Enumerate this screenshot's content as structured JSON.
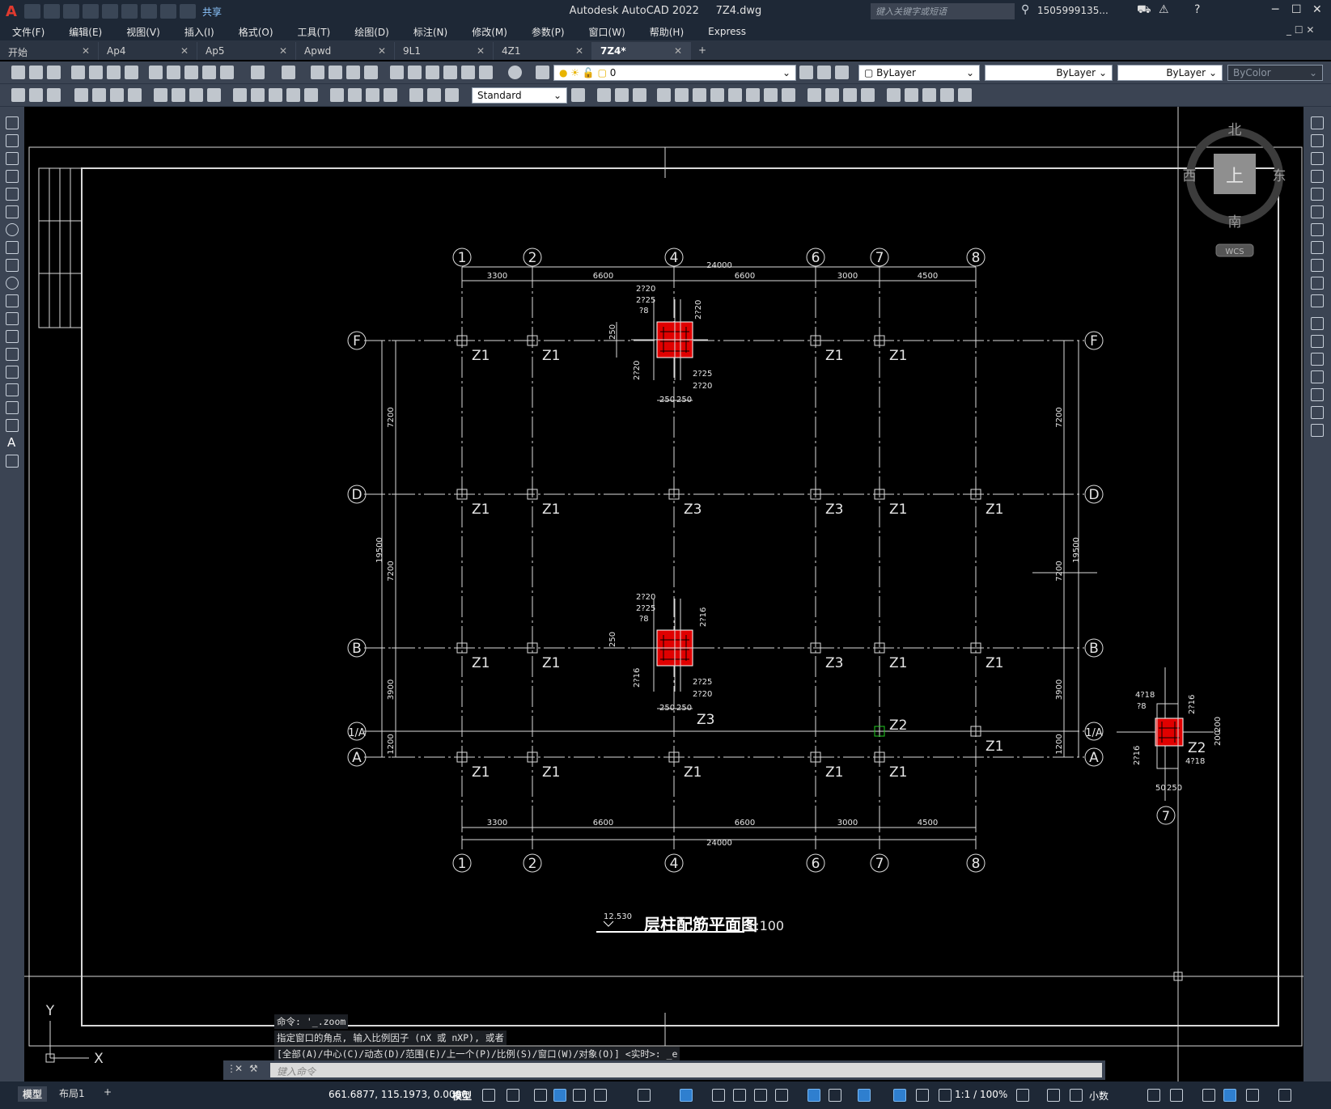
{
  "titlebar": {
    "logo": "A",
    "share": "共享",
    "app_name": "Autodesk AutoCAD 2022",
    "file_name": "7Z4.dwg",
    "search_placeholder": "键入关键字或短语",
    "user": "1505999135..."
  },
  "menu": [
    "文件(F)",
    "编辑(E)",
    "视图(V)",
    "插入(I)",
    "格式(O)",
    "工具(T)",
    "绘图(D)",
    "标注(N)",
    "修改(M)",
    "参数(P)",
    "窗口(W)",
    "帮助(H)",
    "Express"
  ],
  "tabs": [
    {
      "label": "开始"
    },
    {
      "label": "Ap4"
    },
    {
      "label": "Ap5"
    },
    {
      "label": "Apwd"
    },
    {
      "label": "9L1"
    },
    {
      "label": "4Z1"
    },
    {
      "label": "7Z4*"
    }
  ],
  "properties": {
    "layer": "0",
    "color": "ByLayer",
    "linetype": "ByLayer",
    "lineweight": "ByLayer",
    "plotstyle": "ByColor",
    "textstyle": "Standard"
  },
  "viewcube": {
    "north": "北",
    "south": "南",
    "east": "东",
    "west": "西",
    "face": "上",
    "wcs": "WCS"
  },
  "drawing": {
    "col_axes": [
      "1",
      "2",
      "4",
      "6",
      "7",
      "8"
    ],
    "row_axes": [
      "F",
      "D",
      "B",
      "1/A",
      "A"
    ],
    "top_dims": [
      "3300",
      "6600",
      "6600",
      "3000",
      "4500"
    ],
    "total_width": "24000",
    "left_dims": [
      "7200",
      "7200",
      "3900",
      "1200"
    ],
    "total_height": "19500",
    "right_dims": [
      "7200",
      "7200",
      "3900",
      "1200"
    ],
    "row_F_labels": [
      "Z1",
      "Z1",
      "Z1",
      "Z1"
    ],
    "row_D_labels": [
      "Z1",
      "Z1",
      "Z3",
      "Z3",
      "Z1",
      "Z1"
    ],
    "row_B_labels": [
      "Z1",
      "Z1",
      "Z3",
      "Z1",
      "Z1"
    ],
    "row_1A_labels": [
      "Z3",
      "Z2",
      "Z1"
    ],
    "row_A_labels": [
      "Z1",
      "Z1",
      "Z1",
      "Z1",
      "Z1"
    ],
    "detail_top_rebar": [
      "2?20",
      "2?25",
      "?8",
      "2?20",
      "2?25",
      "2?20",
      "250",
      "250",
      "250",
      "2?20"
    ],
    "detail_mid_rebar": [
      "2?20",
      "2?25",
      "?8",
      "2?16",
      "2?25",
      "2?20",
      "250",
      "250",
      "250",
      "2?16"
    ],
    "detail_z2_rebar": [
      "4?18",
      "?8",
      "2?16",
      "2?16",
      "4?18",
      "50",
      "250",
      "200",
      "200",
      "Z2",
      "7"
    ],
    "elevation": "12.530",
    "plan_title": "层柱配筋平面图",
    "scale": "1:100"
  },
  "ucs": {
    "y": "Y",
    "x": "X"
  },
  "command_history": [
    "命令: '_.zoom",
    "指定窗口的角点, 输入比例因子 (nX 或 nXP), 或者",
    "[全部(A)/中心(C)/动态(D)/范围(E)/上一个(P)/比例(S)/窗口(W)/对象(O)] <实时>: _e"
  ],
  "command_placeholder": "键入命令",
  "status": {
    "model_tab": "模型",
    "layout_tab": "布局1",
    "add_tab": "+",
    "coords": "661.6877, 115.1973, 0.0000",
    "model_label": "模型",
    "scale": "1:1 / 100%",
    "units": "小数"
  }
}
